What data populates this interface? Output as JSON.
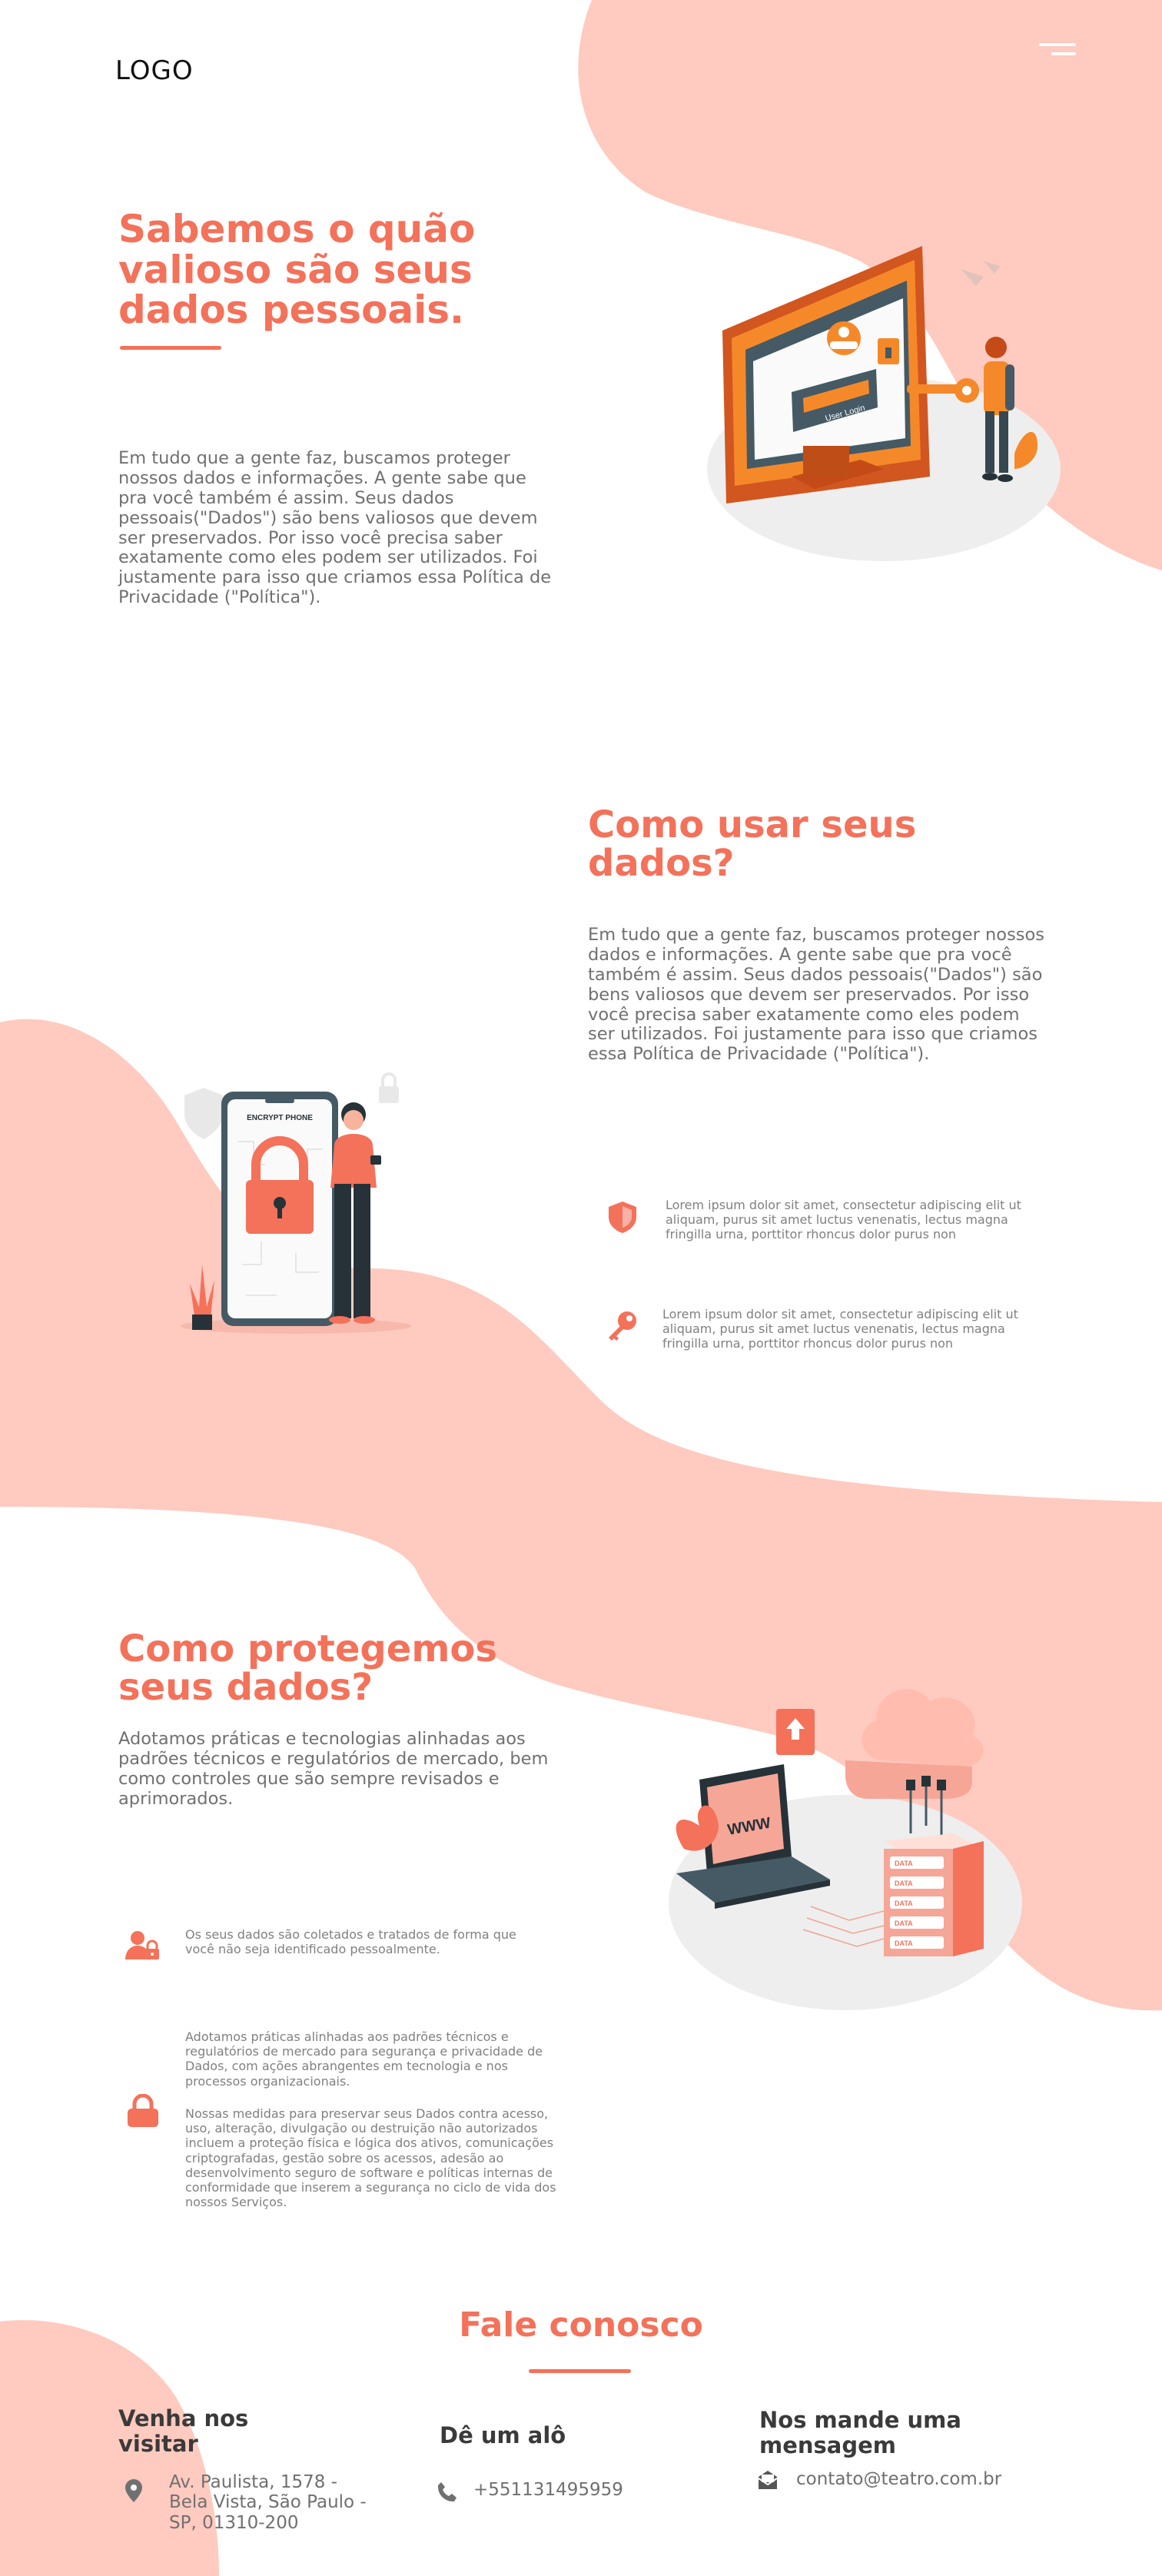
{
  "header": {
    "logo": "LOGO",
    "menu_icon": "hamburger-menu-icon"
  },
  "hero": {
    "title": "Sabemos o quão valioso são seus dados pessoais.",
    "paragraph": "Em tudo que a gente faz, buscamos proteger nossos dados e informações. A gente sabe que pra você também é assim. Seus dados pessoais(\"Dados\") são bens valiosos que devem ser preservados. Por isso você precisa saber exatamente como eles podem ser utilizados. Foi justamente para isso que criamos essa Política de Privacidade (\"Política\").",
    "illustration": {
      "label": "User Login"
    }
  },
  "usage": {
    "title": "Como usar seus dados?",
    "paragraph": "Em tudo que a gente faz, buscamos proteger nossos dados e informações. A gente sabe que pra você também é assim. Seus dados pessoais(\"Dados\") são bens valiosos que devem ser preservados. Por isso você precisa saber exatamente como eles podem ser utilizados. Foi justamente para isso que criamos essa Política de Privacidade (\"Política\").",
    "illustration": {
      "phone_label": "ENCRYPT PHONE"
    },
    "features": [
      {
        "icon": "shield-icon",
        "text": "Lorem ipsum dolor sit amet, consectetur adipiscing elit ut aliquam, purus sit amet luctus venenatis, lectus magna fringilla urna, porttitor rhoncus dolor purus non"
      },
      {
        "icon": "key-icon",
        "text": "Lorem ipsum dolor sit amet, consectetur adipiscing elit ut aliquam, purus sit amet luctus venenatis, lectus magna fringilla urna, porttitor rhoncus dolor purus non"
      }
    ]
  },
  "protect": {
    "title": "Como protegemos seus dados?",
    "paragraph": "Adotamos práticas e tecnologias alinhadas aos padrões técnicos e regulatórios de mercado, bem como controles que são sempre revisados e aprimorados.",
    "illustration": {
      "screen_label": "WWW",
      "server_label": "DATA"
    },
    "features": [
      {
        "icon": "user-lock-icon",
        "text": "Os seus dados são coletados e tratados de forma que você não seja identificado pessoalmente."
      },
      {
        "icon": "lock-icon",
        "text_1": "Adotamos práticas alinhadas aos padrões técnicos e regulatórios de mercado para segurança e privacidade de Dados, com ações abrangentes em tecnologia e nos processos organizacionais.",
        "text_2": "Nossas medidas para preservar seus Dados contra acesso, uso, alteração, divulgação ou destruição não autorizados incluem a proteção física e lógica dos ativos, comunicações criptografadas, gestão sobre os acessos, adesão ao desenvolvimento seguro de software e políticas internas de conformidade que inserem a segurança no ciclo de vida dos nossos Serviços."
      }
    ]
  },
  "contact": {
    "title": "Fale conosco",
    "visit": {
      "title": "Venha nos visitar",
      "icon": "location-pin-icon",
      "address": "Av. Paulista, 1578 - Bela Vista, São Paulo - SP, 01310-200"
    },
    "call": {
      "title": "Dê um alô",
      "icon": "phone-icon",
      "phone": "+551131495959"
    },
    "mail": {
      "title": "Nos mande uma mensagem",
      "icon": "mail-icon",
      "email": "contato@teatro.com.br"
    }
  },
  "colors": {
    "accent": "#f4715a",
    "blob": "#ffcabf",
    "heading_dark": "#3a3a3a",
    "body_text": "#707070"
  }
}
